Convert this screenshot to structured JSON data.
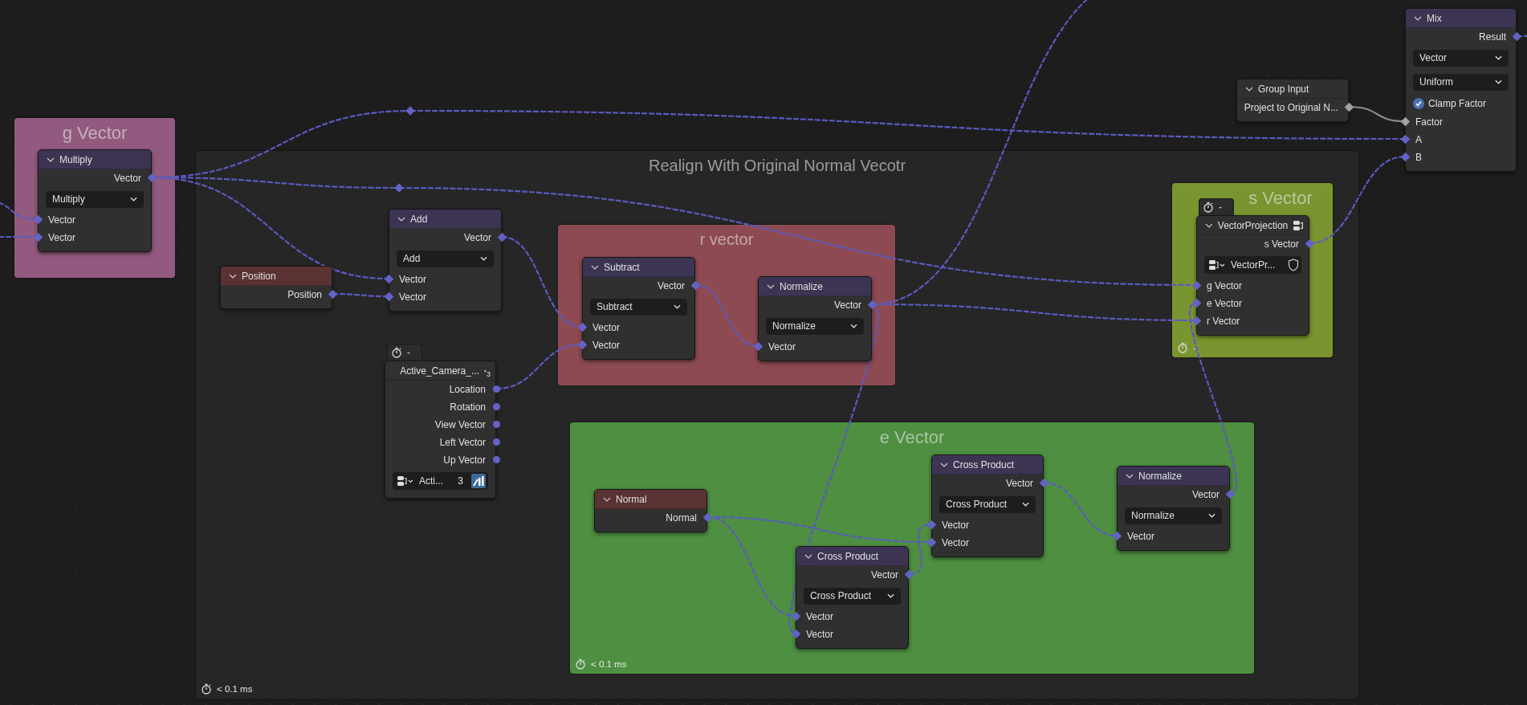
{
  "frames": [
    {
      "label": "g Vector",
      "color": "#925a7e"
    },
    {
      "label": "Realign With Original Normal Vecotr",
      "color": "#262626",
      "timing": "< 0.1 ms"
    },
    {
      "label": "s Vector",
      "color": "#7a952f",
      "timing": "-"
    },
    {
      "label": "r vector",
      "color": "#8e4a52"
    },
    {
      "label": "e Vector",
      "color": "#4e8f41",
      "timing": "< 0.1 ms"
    }
  ],
  "nodes": [
    {
      "title": "Mix",
      "kind": "builtin",
      "color": "#3c3452",
      "rows": [
        {
          "kind": "output",
          "label": "Result",
          "socket": {
            "kind": "field",
            "color": "#6363c7"
          }
        },
        {
          "kind": "dropdown",
          "label": "Vector"
        },
        {
          "kind": "dropdown",
          "label": "Uniform"
        },
        {
          "kind": "checkbox",
          "label": "Clamp Factor",
          "checked": true
        },
        {
          "kind": "input",
          "label": "Factor",
          "socket": {
            "kind": "field",
            "color": "#a1a1a1"
          }
        },
        {
          "kind": "input",
          "label": "A",
          "socket": {
            "kind": "field",
            "color": "#6363c7"
          }
        },
        {
          "kind": "input",
          "label": "B",
          "socket": {
            "kind": "field",
            "color": "#6363c7"
          }
        }
      ]
    },
    {
      "title": "Group Input",
      "kind": "builtin",
      "color": "#303030",
      "rows": [
        {
          "kind": "output",
          "label": "Project to Original N...",
          "socket": {
            "kind": "field",
            "color": "#a1a1a1"
          }
        }
      ]
    },
    {
      "title": "Multiply",
      "kind": "builtin",
      "color": "#3c3452",
      "rows": [
        {
          "kind": "output",
          "label": "Vector",
          "socket": {
            "kind": "field",
            "color": "#6363c7"
          }
        },
        {
          "kind": "dropdown",
          "label": "Multiply"
        },
        {
          "kind": "input",
          "label": "Vector",
          "socket": {
            "kind": "field",
            "color": "#6363c7"
          }
        },
        {
          "kind": "input",
          "label": "Vector",
          "socket": {
            "kind": "field",
            "color": "#6363c7"
          }
        }
      ]
    },
    {
      "title": "Add",
      "kind": "builtin",
      "color": "#3c3452",
      "rows": [
        {
          "kind": "output",
          "label": "Vector",
          "socket": {
            "kind": "field",
            "color": "#6363c7"
          }
        },
        {
          "kind": "dropdown",
          "label": "Add"
        },
        {
          "kind": "input",
          "label": "Vector",
          "socket": {
            "kind": "field",
            "color": "#6363c7"
          }
        },
        {
          "kind": "input",
          "label": "Vector",
          "socket": {
            "kind": "field",
            "color": "#6363c7"
          }
        }
      ]
    },
    {
      "title": "VectorProjection",
      "kind": "group",
      "timing": "-",
      "color": "#303030",
      "rows": [
        {
          "kind": "output",
          "label": "s Vector",
          "socket": {
            "kind": "field",
            "color": "#6363c7"
          }
        },
        {
          "kind": "datablock",
          "label": "VectorPr...",
          "protected": false
        },
        {
          "kind": "input",
          "label": "g Vector",
          "socket": {
            "kind": "field",
            "color": "#6363c7"
          }
        },
        {
          "kind": "input",
          "label": "e Vector",
          "socket": {
            "kind": "field",
            "color": "#6363c7"
          }
        },
        {
          "kind": "input",
          "label": "r Vector",
          "socket": {
            "kind": "field",
            "color": "#6363c7"
          }
        }
      ]
    },
    {
      "title": "Subtract",
      "kind": "builtin",
      "color": "#3c3452",
      "rows": [
        {
          "kind": "output",
          "label": "Vector",
          "socket": {
            "kind": "field",
            "color": "#6363c7"
          }
        },
        {
          "kind": "dropdown",
          "label": "Subtract"
        },
        {
          "kind": "input",
          "label": "Vector",
          "socket": {
            "kind": "field",
            "color": "#6363c7"
          }
        },
        {
          "kind": "input",
          "label": "Vector",
          "socket": {
            "kind": "field",
            "color": "#6363c7"
          }
        }
      ]
    },
    {
      "title": "Position",
      "kind": "builtin",
      "color": "#5a3233",
      "rows": [
        {
          "kind": "output",
          "label": "Position",
          "socket": {
            "kind": "field",
            "color": "#6363c7"
          }
        }
      ]
    },
    {
      "title": "Normalize",
      "kind": "builtin",
      "color": "#3c3452",
      "rows": [
        {
          "kind": "output",
          "label": "Vector",
          "socket": {
            "kind": "field",
            "color": "#6363c7"
          }
        },
        {
          "kind": "dropdown",
          "label": "Normalize"
        },
        {
          "kind": "input",
          "label": "Vector",
          "socket": {
            "kind": "field",
            "color": "#6363c7"
          }
        }
      ]
    },
    {
      "title": "Active_Camera_...",
      "kind": "group",
      "users": "3",
      "timing": "-",
      "color": "#303030",
      "rows": [
        {
          "kind": "output",
          "label": "Location",
          "socket": {
            "kind": "single",
            "color": "#6363c7"
          }
        },
        {
          "kind": "output",
          "label": "Rotation",
          "socket": {
            "kind": "single",
            "color": "#6363c7"
          }
        },
        {
          "kind": "output",
          "label": "View Vector",
          "socket": {
            "kind": "single",
            "color": "#6363c7"
          }
        },
        {
          "kind": "output",
          "label": "Left Vector",
          "socket": {
            "kind": "single",
            "color": "#6363c7"
          }
        },
        {
          "kind": "output",
          "label": "Up Vector",
          "socket": {
            "kind": "single",
            "color": "#6363c7"
          }
        },
        {
          "kind": "datablock",
          "label": "Acti...",
          "users": "3",
          "active": true
        }
      ]
    },
    {
      "title": "Normal",
      "kind": "builtin",
      "color": "#5a3233",
      "rows": [
        {
          "kind": "output",
          "label": "Normal",
          "socket": {
            "kind": "field",
            "color": "#6363c7"
          }
        }
      ]
    },
    {
      "title": "Cross Product",
      "kind": "builtin",
      "color": "#3c3452",
      "rows": [
        {
          "kind": "output",
          "label": "Vector",
          "socket": {
            "kind": "field",
            "color": "#6363c7"
          }
        },
        {
          "kind": "dropdown",
          "label": "Cross Product"
        },
        {
          "kind": "input",
          "label": "Vector",
          "socket": {
            "kind": "field",
            "color": "#6363c7"
          }
        },
        {
          "kind": "input",
          "label": "Vector",
          "socket": {
            "kind": "field",
            "color": "#6363c7"
          }
        }
      ]
    },
    {
      "title": "Normalize",
      "kind": "builtin",
      "color": "#3c3452",
      "rows": [
        {
          "kind": "output",
          "label": "Vector",
          "socket": {
            "kind": "field",
            "color": "#6363c7"
          }
        },
        {
          "kind": "dropdown",
          "label": "Normalize"
        },
        {
          "kind": "input",
          "label": "Vector",
          "socket": {
            "kind": "field",
            "color": "#6363c7"
          }
        }
      ]
    },
    {
      "title": "Cross Product",
      "kind": "builtin",
      "color": "#3c3452",
      "rows": [
        {
          "kind": "output",
          "label": "Vector",
          "socket": {
            "kind": "field",
            "color": "#6363c7"
          }
        },
        {
          "kind": "dropdown",
          "label": "Cross Product"
        },
        {
          "kind": "input",
          "label": "Vector",
          "socket": {
            "kind": "field",
            "color": "#6363c7"
          }
        },
        {
          "kind": "input",
          "label": "Vector",
          "socket": {
            "kind": "field",
            "color": "#6363c7"
          }
        }
      ]
    }
  ]
}
